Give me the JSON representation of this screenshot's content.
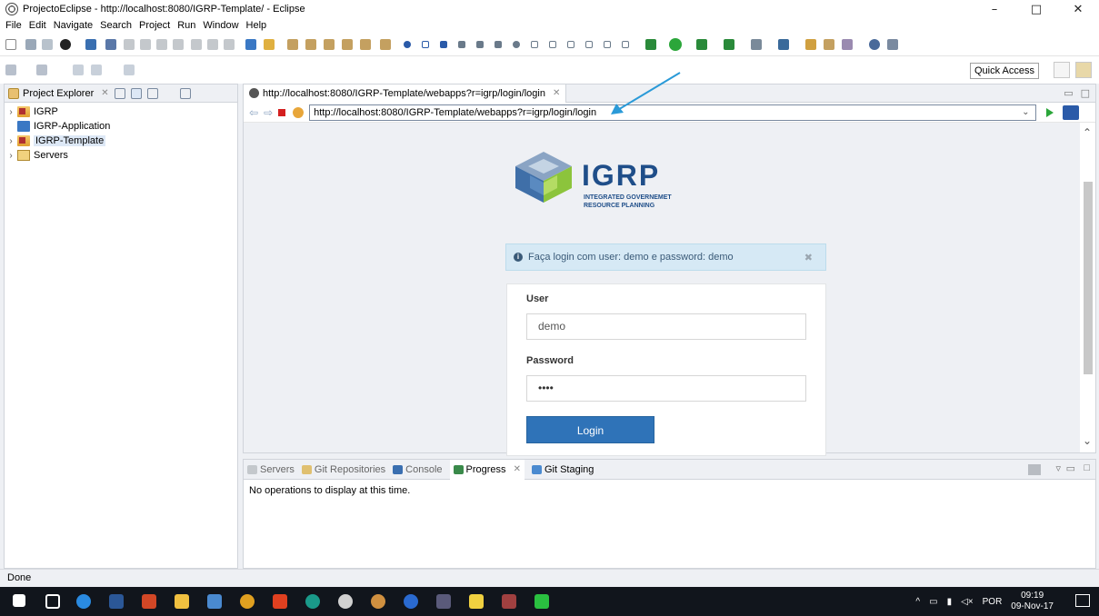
{
  "window": {
    "title": "ProjectoEclipse - http://localhost:8080/IGRP-Template/ - Eclipse",
    "controls": [
      "–",
      "□",
      "✕"
    ]
  },
  "menu": [
    "File",
    "Edit",
    "Navigate",
    "Search",
    "Project",
    "Run",
    "Window",
    "Help"
  ],
  "toolbar": {
    "quick_access": "Quick Access"
  },
  "explorer": {
    "tab_label": "Project Explorer",
    "items": [
      {
        "label": "IGRP",
        "expandable": true
      },
      {
        "label": "IGRP-Application",
        "expandable": false
      },
      {
        "label": "IGRP-Template",
        "expandable": true,
        "selected": true
      },
      {
        "label": "Servers",
        "expandable": true
      }
    ]
  },
  "editor": {
    "tab_label": "http://localhost:8080/IGRP-Template/webapps?r=igrp/login/login",
    "url": "http://localhost:8080/IGRP-Template/webapps?r=igrp/login/login"
  },
  "page": {
    "brand": "IGRP",
    "brand_sub_line1": "INTEGRATED GOVERNEMET",
    "brand_sub_line2": "RESOURCE PLANNING",
    "alert": "Faça login com user: demo e password: demo",
    "user_label": "User",
    "user_value": "demo",
    "password_label": "Password",
    "password_value": "••••",
    "login_button": "Login"
  },
  "bottom": {
    "tabs": [
      "Servers",
      "Git Repositories",
      "Console",
      "Progress",
      "Git Staging"
    ],
    "active_tab": "Progress",
    "message": "No operations to display at this time."
  },
  "status": {
    "text": "Done"
  },
  "taskbar": {
    "language": "POR",
    "time": "09:19",
    "date": "09-Nov-17"
  },
  "colors": {
    "brand_blue": "#1f4e89",
    "login_button": "#2f73b8",
    "alert_bg": "#d6e9f5",
    "arrow": "#2a9ad8"
  }
}
